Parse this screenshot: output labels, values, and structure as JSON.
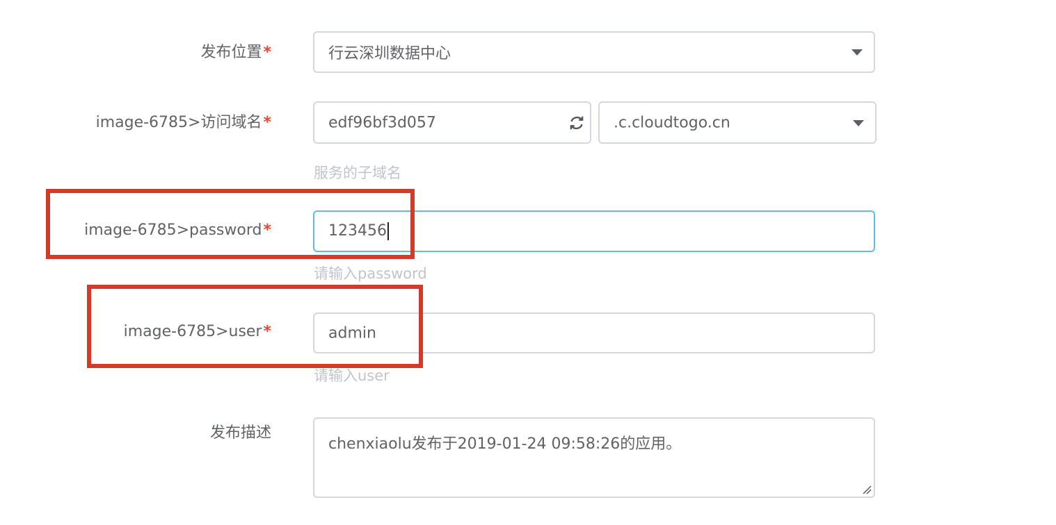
{
  "form": {
    "location": {
      "label": "发布位置",
      "value": "行云深圳数据中心"
    },
    "domain": {
      "label": "image-6785>访问域名",
      "subdomain": "edf96bf3d057",
      "suffix": ".c.cloudtogo.cn",
      "hint": "服务的子域名"
    },
    "password": {
      "label": "image-6785>password",
      "value": "123456",
      "hint": "请输入password"
    },
    "user": {
      "label": "image-6785>user",
      "value": "admin",
      "hint": "请输入user"
    },
    "description": {
      "label": "发布描述",
      "value": "chenxiaolu发布于2019-01-24 09:58:26的应用。"
    },
    "required_mark": "*"
  },
  "colors": {
    "highlight": "#d23a2a",
    "required": "#e8472f",
    "focus_border": "#5dbcea"
  },
  "icons": {
    "refresh": "refresh-icon",
    "dropdown": "chevron-down-icon",
    "resize": "resize-handle-icon"
  }
}
